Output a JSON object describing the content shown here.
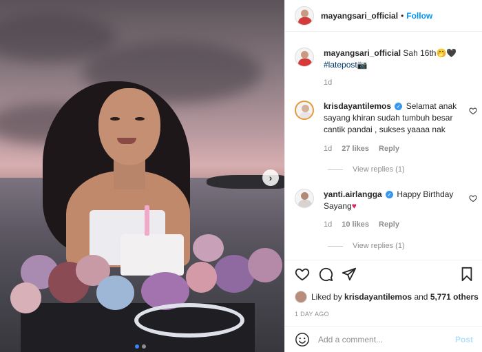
{
  "post": {
    "author": "mayangsari_official",
    "follow_label": "Follow",
    "separator": "•"
  },
  "caption": {
    "username": "mayangsari_official",
    "text": "Sah 16th",
    "emoji": "🤭🖤",
    "hashtag": "#latepost",
    "camera": "📷",
    "time": "1d"
  },
  "comments": [
    {
      "username": "krisdayantilemos",
      "verified": true,
      "text": "Selamat anak sayang khiran sudah tumbuh besar cantik pandai , sukses yaaaa nak",
      "time": "1d",
      "likes": "27 likes",
      "reply_label": "Reply",
      "view_replies": "View replies (1)"
    },
    {
      "username": "yanti.airlangga",
      "verified": true,
      "text": "Happy Birthday Sayang",
      "emoji": "♥",
      "time": "1d",
      "likes": "10 likes",
      "reply_label": "Reply",
      "view_replies": "View replies (1)"
    }
  ],
  "liked_by": {
    "prefix": "Liked by",
    "user": "krisdayantilemos",
    "joiner": "and",
    "others": "5,771 others"
  },
  "date": "1 DAY AGO",
  "composer": {
    "placeholder": "Add a comment...",
    "post_label": "Post"
  },
  "carousel": {
    "slides": 2,
    "current": 1
  },
  "colors": {
    "accent": "#0095f6",
    "muted": "#8e8e8e",
    "verified": "#3897f0"
  }
}
